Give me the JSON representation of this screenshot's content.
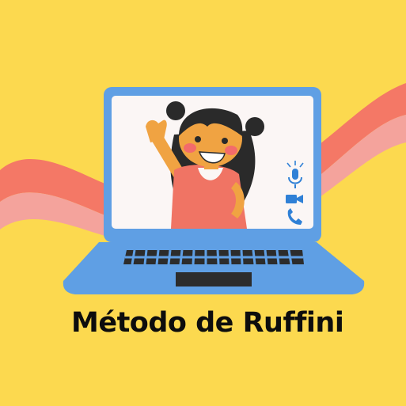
{
  "title": "Método de Ruffini",
  "colors": {
    "background": "#fcd94f",
    "rainbow_outer": "#f47866",
    "rainbow_inner": "#f4a39c",
    "laptop_frame": "#5f9fe4",
    "screen": "#fbf6f5",
    "keyboard": "#2c2c2c",
    "shirt": "#f07464",
    "skin": "#f0a342",
    "hair": "#2a2a2a",
    "icon_blue": "#2f80d6"
  },
  "icons": [
    "microphone-icon",
    "video-camera-icon",
    "phone-icon"
  ]
}
